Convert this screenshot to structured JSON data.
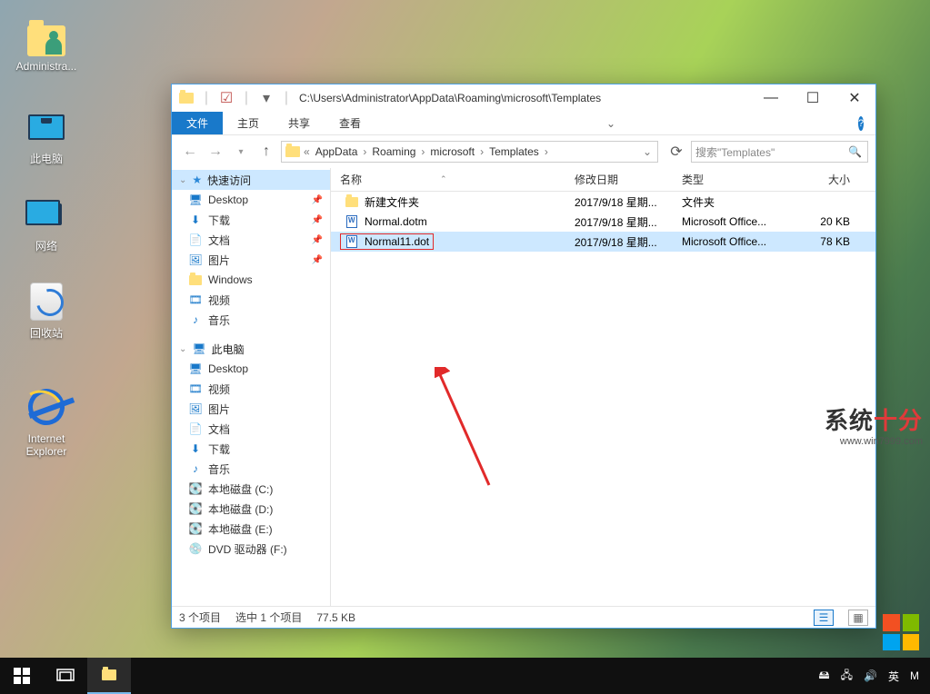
{
  "desktop": {
    "icons": [
      {
        "label": "Administra..."
      },
      {
        "label": "此电脑"
      },
      {
        "label": "网络"
      },
      {
        "label": "回收站"
      },
      {
        "label": "Internet Explorer"
      }
    ]
  },
  "window": {
    "title": "C:\\Users\\Administrator\\AppData\\Roaming\\microsoft\\Templates",
    "tabs": {
      "file": "文件",
      "home": "主页",
      "share": "共享",
      "view": "查看"
    },
    "breadcrumb": {
      "root_glyph": "«",
      "segs": [
        "AppData",
        "Roaming",
        "microsoft",
        "Templates"
      ]
    },
    "search_placeholder": "搜索\"Templates\"",
    "sidebar": {
      "quick": {
        "header": "快速访问",
        "items": [
          {
            "label": "Desktop",
            "pinned": true
          },
          {
            "label": "下载",
            "pinned": true
          },
          {
            "label": "文档",
            "pinned": true
          },
          {
            "label": "图片",
            "pinned": true
          },
          {
            "label": "Windows",
            "pinned": false
          },
          {
            "label": "视频",
            "pinned": false
          },
          {
            "label": "音乐",
            "pinned": false
          }
        ]
      },
      "thispc": {
        "header": "此电脑",
        "items": [
          {
            "label": "Desktop"
          },
          {
            "label": "视频"
          },
          {
            "label": "图片"
          },
          {
            "label": "文档"
          },
          {
            "label": "下载"
          },
          {
            "label": "音乐"
          },
          {
            "label": "本地磁盘 (C:)"
          },
          {
            "label": "本地磁盘 (D:)"
          },
          {
            "label": "本地磁盘 (E:)"
          },
          {
            "label": "DVD 驱动器 (F:)"
          }
        ]
      }
    },
    "columns": {
      "name": "名称",
      "date": "修改日期",
      "type": "类型",
      "size": "大小"
    },
    "rows": [
      {
        "name": "新建文件夹",
        "date": "2017/9/18 星期...",
        "type": "文件夹",
        "size": ""
      },
      {
        "name": "Normal.dotm",
        "date": "2017/9/18 星期...",
        "type": "Microsoft Office...",
        "size": "20 KB"
      },
      {
        "name": "Normal11.dot",
        "date": "2017/9/18 星期...",
        "type": "Microsoft Office...",
        "size": "78 KB"
      }
    ],
    "status": {
      "count": "3 个项目",
      "selected": "选中 1 个项目",
      "selsize": "77.5 KB"
    }
  },
  "watermark": {
    "brand_a": "系统",
    "brand_b": "十分",
    "url": "www.win7999.com"
  },
  "tray": {
    "ime1": "英",
    "ime2": "M"
  }
}
